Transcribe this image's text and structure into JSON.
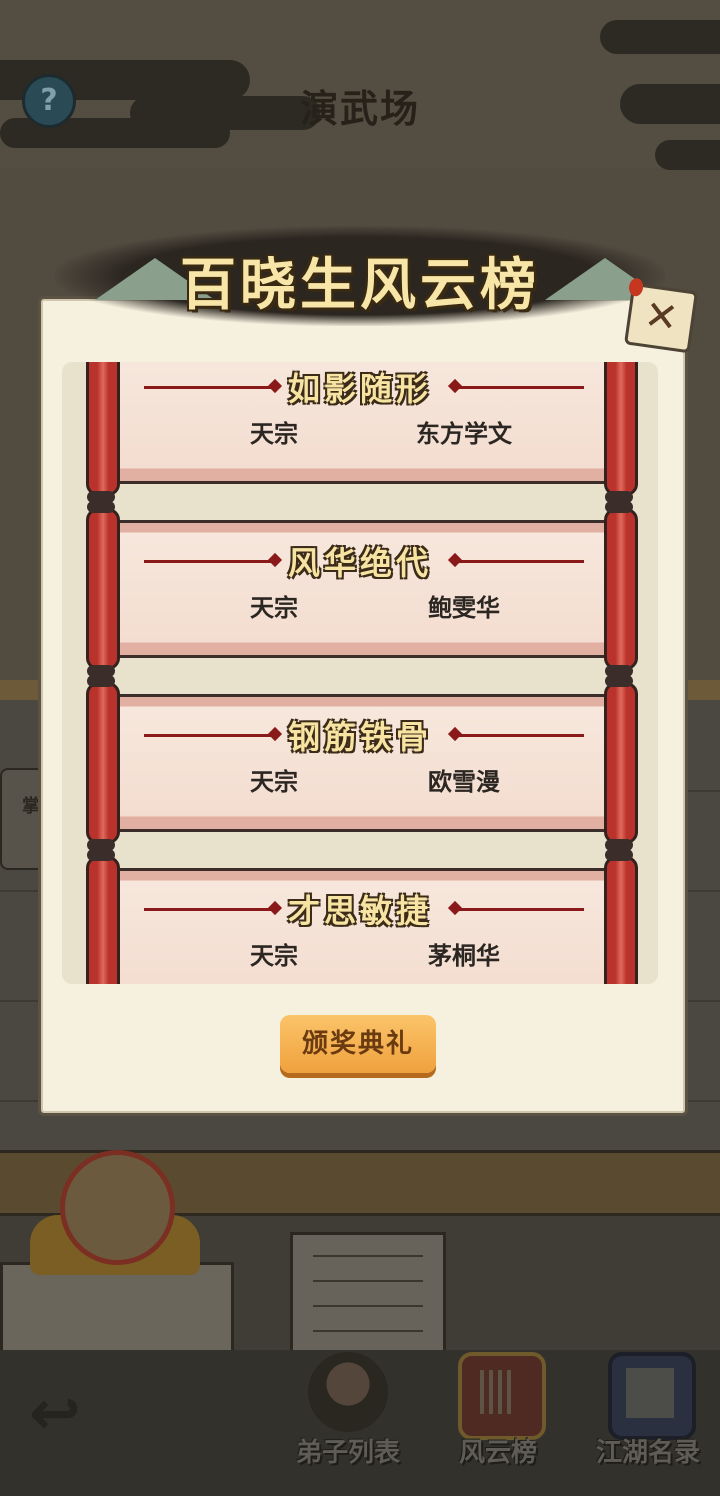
{
  "header": {
    "title": "演武场",
    "help_icon": "question-icon"
  },
  "background": {
    "side_sign_char": "掌"
  },
  "modal": {
    "banner_title": "百晓生风云榜",
    "close_icon": "close-icon",
    "entries": [
      {
        "title": "如影随形",
        "sect": "天宗",
        "name": "东方学文"
      },
      {
        "title": "风华绝代",
        "sect": "天宗",
        "name": "鲍雯华"
      },
      {
        "title": "钢筋铁骨",
        "sect": "天宗",
        "name": "欧雪漫"
      },
      {
        "title": "才思敏捷",
        "sect": "天宗",
        "name": "茅桐华"
      }
    ],
    "award_button": "颁奖典礼"
  },
  "bottom_nav": {
    "back_icon": "back-arrow-icon",
    "items": [
      {
        "label": "弟子列表",
        "icon": "disciple-icon"
      },
      {
        "label": "风云榜",
        "icon": "ranking-scroll-icon"
      },
      {
        "label": "江湖名录",
        "icon": "book-icon"
      }
    ]
  },
  "colors": {
    "modal_bg": "#f6f1df",
    "scroll_red": "#b9332c",
    "gold_text": "#f7e3a2",
    "button_orange": "#f0a13d"
  }
}
